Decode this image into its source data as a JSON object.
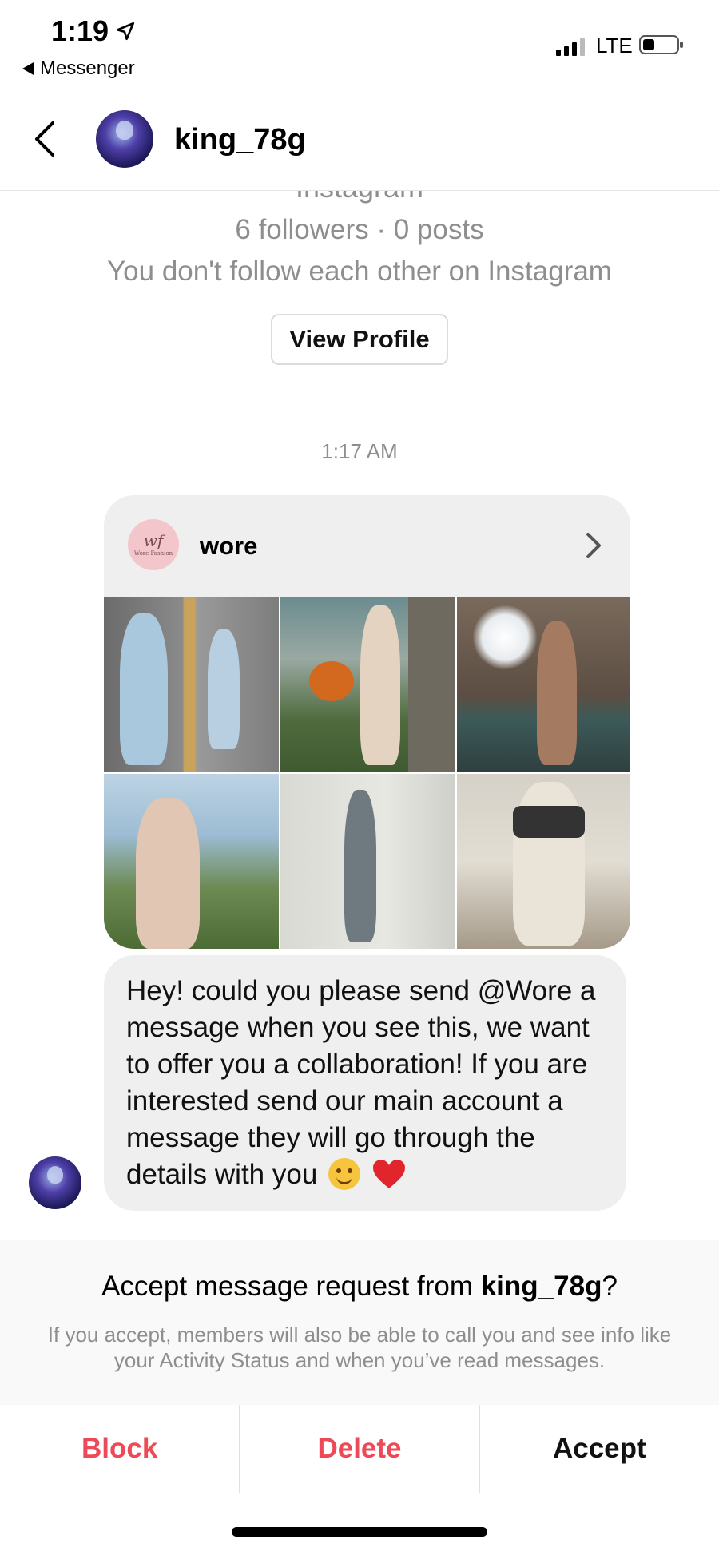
{
  "status_bar": {
    "time": "1:19",
    "back_app": "Messenger",
    "network": "LTE"
  },
  "header": {
    "username": "king_78g"
  },
  "profile": {
    "platform_partial": "Instagram",
    "followers_posts": "6 followers · 0 posts",
    "follow_status": "You don't follow each other on Instagram",
    "view_profile_label": "View Profile"
  },
  "conversation": {
    "timestamp": "1:17 AM",
    "shared_profile": {
      "name": "wore",
      "logo_monogram": "wf",
      "logo_text": "Wore Fashion",
      "photos": [
        "photo-1",
        "photo-2",
        "photo-3",
        "photo-4",
        "photo-5",
        "photo-6"
      ]
    },
    "message": "Hey! could you please send @Wore a message when you see this, we want to offer you a collaboration! If you are interested send our main account a message they will go through the details with you"
  },
  "request": {
    "title_prefix": "Accept message request from ",
    "title_user": "king_78g",
    "title_suffix": "?",
    "info": "If you accept, members will also be able to call you and see info like your Activity Status and when you’ve read messages."
  },
  "actions": {
    "block": "Block",
    "delete": "Delete",
    "accept": "Accept"
  },
  "colors": {
    "danger": "#ed4956",
    "bubble": "#efefef",
    "muted": "#8e8e8e"
  }
}
